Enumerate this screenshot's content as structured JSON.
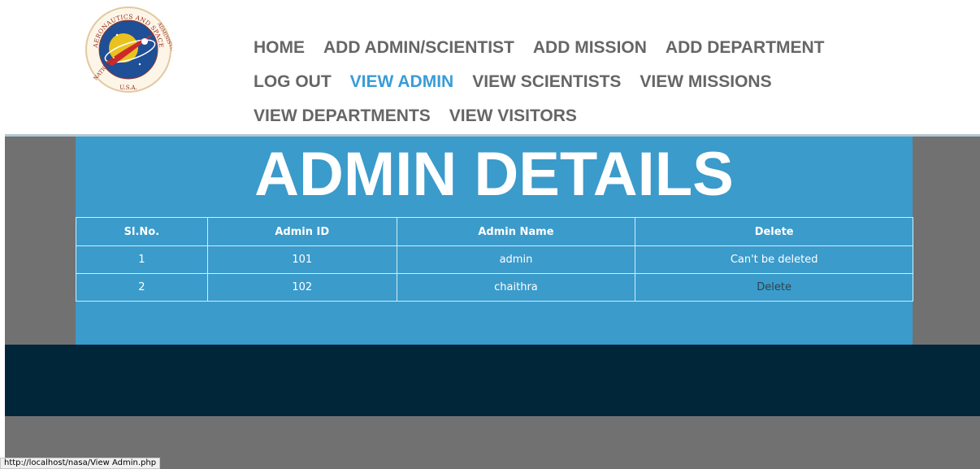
{
  "header": {
    "logo": {
      "icon": "nasa-seal-icon",
      "text_top": "AERONAUTICS AND SPACE",
      "text_left": "NATIONAL",
      "text_right": "ADMINISTRATION",
      "text_bottom": "U.S.A."
    },
    "nav": [
      {
        "label": "HOME",
        "active": false
      },
      {
        "label": "ADD ADMIN/SCIENTIST",
        "active": false
      },
      {
        "label": "ADD MISSION",
        "active": false
      },
      {
        "label": "ADD DEPARTMENT",
        "active": false
      },
      {
        "label": "LOG OUT",
        "active": false
      },
      {
        "label": "VIEW ADMIN",
        "active": true
      },
      {
        "label": "VIEW SCIENTISTS",
        "active": false
      },
      {
        "label": "VIEW MISSIONS",
        "active": false
      },
      {
        "label": "VIEW DEPARTMENTS",
        "active": false
      },
      {
        "label": "VIEW VISITORS",
        "active": false
      }
    ]
  },
  "main": {
    "title": "ADMIN DETAILS",
    "table": {
      "headers": [
        "Sl.No.",
        "Admin ID",
        "Admin Name",
        "Delete"
      ],
      "rows": [
        {
          "sl": "1",
          "id": "101",
          "name": "admin",
          "action": "Can't be deleted",
          "action_is_link": false
        },
        {
          "sl": "2",
          "id": "102",
          "name": "chaithra",
          "action": "Delete",
          "action_is_link": true
        }
      ]
    }
  },
  "status_bar": {
    "url": "http://localhost/nasa/View Admin.php"
  },
  "colors": {
    "accent": "#3a9cd8",
    "panel": "#3b9bcb",
    "nav_text": "#666666",
    "footer": "#012639",
    "gray_bg": "#717171"
  }
}
